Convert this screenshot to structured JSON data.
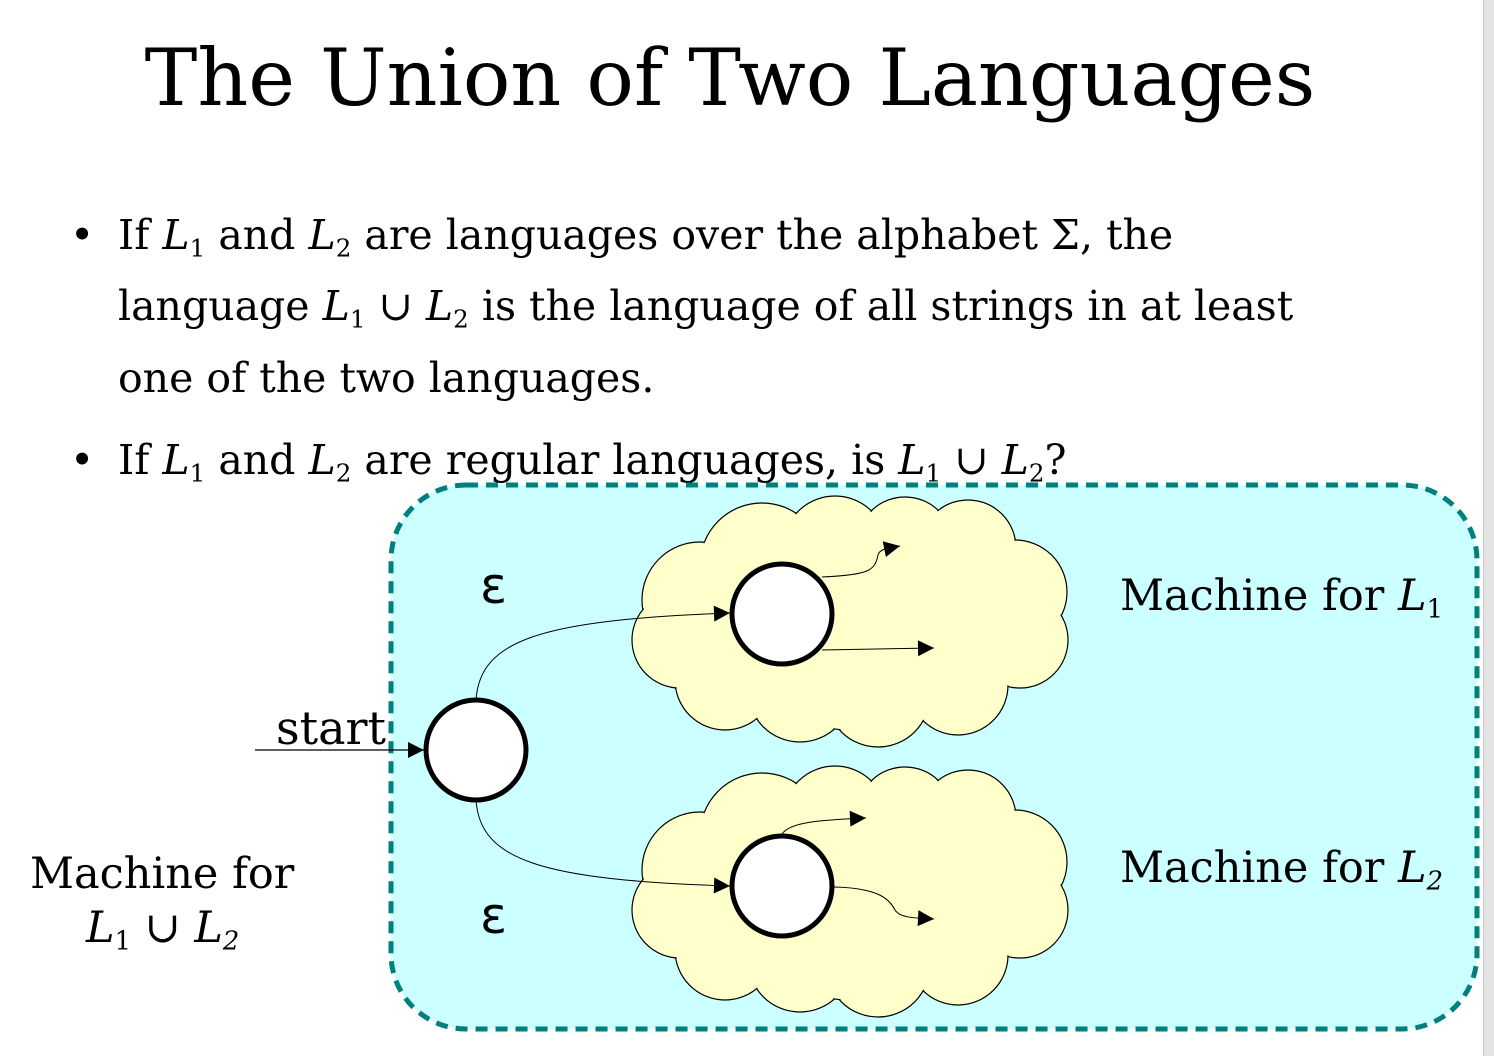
{
  "slide": {
    "title": "The Union of Two Languages",
    "bullets": [
      [
        {
          "t": "If "
        },
        {
          "v": "L",
          "s": "1"
        },
        {
          "t": " and "
        },
        {
          "v": "L",
          "s": "2"
        },
        {
          "t": " are languages over the alphabet Σ, the language "
        },
        {
          "v": "L",
          "s": "1"
        },
        {
          "t": " ∪ "
        },
        {
          "v": "L",
          "s": "2"
        },
        {
          "t": " is the language of all strings in at least one of the two languages."
        }
      ],
      [
        {
          "t": "If "
        },
        {
          "v": "L",
          "s": "1"
        },
        {
          "t": " and "
        },
        {
          "v": "L",
          "s": "2"
        },
        {
          "t": " are regular languages, is "
        },
        {
          "v": "L",
          "s": "1"
        },
        {
          "t": " ∪ "
        },
        {
          "v": "L",
          "s": "2"
        },
        {
          "t": "?"
        }
      ]
    ],
    "bullet_glyph": "•"
  },
  "diagram": {
    "start_label": "start",
    "epsilon_top": "ε",
    "epsilon_bottom": "ε",
    "machine_l1": {
      "text": "Machine for ",
      "var": "L",
      "sub": "1"
    },
    "machine_l2": {
      "text": "Machine for ",
      "var": "L",
      "sub": "2"
    },
    "machine_union": {
      "line1": "Machine for",
      "var1": "L",
      "sub1": "1",
      "op": " ∪ ",
      "var2": "L",
      "sub2": "2"
    },
    "colors": {
      "box_fill": "#ccffff",
      "box_border": "#007f7f",
      "cloud_fill": "#ffffcc",
      "state_fill": "#ffffff"
    }
  }
}
